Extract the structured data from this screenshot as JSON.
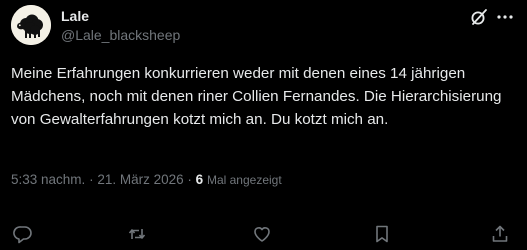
{
  "author": {
    "name": "Lale",
    "handle": "@Lale_blacksheep"
  },
  "tweet": {
    "text": "Meine Erfahrungen konkurrieren weder mit denen eines 14 jährigen Mädchens, noch mit denen riner Collien Fernandes. Die Hierarchisierung von Gewalterfahrungen kotzt mich an. Du kotzt mich an.",
    "time": "5:33 nachm.",
    "separator": "·",
    "date": "21. März 2026",
    "views_count": "6",
    "views_label": "Mal angezeigt"
  },
  "icons": {
    "header": [
      "grok-icon",
      "more-icon"
    ],
    "actions": [
      "reply-icon",
      "retweet-icon",
      "like-icon",
      "bookmark-icon",
      "share-icon"
    ]
  },
  "colors": {
    "background": "#000000",
    "text": "#e7e9ea",
    "secondary": "#71767b"
  }
}
